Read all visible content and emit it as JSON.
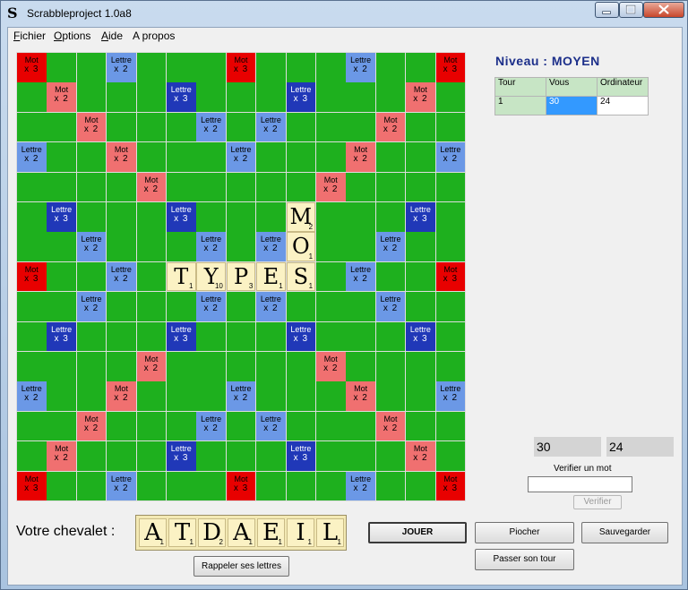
{
  "window": {
    "title": "Scrabbleproject 1.0a8",
    "app_icon": "S"
  },
  "menu": [
    {
      "label": "Fichier",
      "mnemonic": "F",
      "rest": "ichier"
    },
    {
      "label": "Options",
      "mnemonic": "O",
      "rest": "ptions"
    },
    {
      "label": "Aide",
      "mnemonic": "A",
      "rest": "ide"
    },
    {
      "label": "A propos",
      "mnemonic": "",
      "rest": "A propos"
    }
  ],
  "colors": {
    "board_green": "#1eb01e",
    "mot_x3": "#e80000",
    "mot_x2": "#f07070",
    "lettre_x2": "#6b98e6",
    "lettre_x3": "#2038b8",
    "tile": "#fbf2c4",
    "niveau_text": "#1c2f8a"
  },
  "bonus_labels": {
    "mot": "Mot",
    "lettre": "Lettre",
    "x2": "x 2",
    "x3": "x 3"
  },
  "board": {
    "size": 15,
    "mot_x3": [
      [
        0,
        0
      ],
      [
        0,
        7
      ],
      [
        0,
        14
      ],
      [
        7,
        0
      ],
      [
        7,
        14
      ],
      [
        14,
        0
      ],
      [
        14,
        7
      ],
      [
        14,
        14
      ]
    ],
    "mot_x2": [
      [
        1,
        1
      ],
      [
        2,
        2
      ],
      [
        3,
        3
      ],
      [
        4,
        4
      ],
      [
        1,
        13
      ],
      [
        2,
        12
      ],
      [
        3,
        11
      ],
      [
        4,
        10
      ],
      [
        10,
        4
      ],
      [
        11,
        3
      ],
      [
        12,
        2
      ],
      [
        13,
        1
      ],
      [
        10,
        10
      ],
      [
        11,
        11
      ],
      [
        12,
        12
      ],
      [
        13,
        13
      ]
    ],
    "lettre_x3": [
      [
        1,
        5
      ],
      [
        1,
        9
      ],
      [
        5,
        1
      ],
      [
        5,
        5
      ],
      [
        5,
        9
      ],
      [
        5,
        13
      ],
      [
        9,
        1
      ],
      [
        9,
        5
      ],
      [
        9,
        9
      ],
      [
        9,
        13
      ],
      [
        13,
        5
      ],
      [
        13,
        9
      ]
    ],
    "lettre_x2": [
      [
        0,
        3
      ],
      [
        0,
        11
      ],
      [
        2,
        6
      ],
      [
        2,
        8
      ],
      [
        3,
        0
      ],
      [
        3,
        7
      ],
      [
        3,
        14
      ],
      [
        6,
        2
      ],
      [
        6,
        6
      ],
      [
        6,
        8
      ],
      [
        6,
        12
      ],
      [
        7,
        3
      ],
      [
        7,
        11
      ],
      [
        8,
        2
      ],
      [
        8,
        6
      ],
      [
        8,
        8
      ],
      [
        8,
        12
      ],
      [
        11,
        0
      ],
      [
        11,
        7
      ],
      [
        11,
        14
      ],
      [
        12,
        6
      ],
      [
        12,
        8
      ],
      [
        14,
        3
      ],
      [
        14,
        11
      ]
    ],
    "tiles": [
      {
        "row": 5,
        "col": 9,
        "letter": "M",
        "value": "2"
      },
      {
        "row": 6,
        "col": 9,
        "letter": "O",
        "value": "1"
      },
      {
        "row": 7,
        "col": 5,
        "letter": "T",
        "value": "1"
      },
      {
        "row": 7,
        "col": 6,
        "letter": "Y",
        "value": "10"
      },
      {
        "row": 7,
        "col": 7,
        "letter": "P",
        "value": "3"
      },
      {
        "row": 7,
        "col": 8,
        "letter": "E",
        "value": "1"
      },
      {
        "row": 7,
        "col": 9,
        "letter": "S",
        "value": "1"
      }
    ]
  },
  "niveau": "Niveau : MOYEN",
  "score_table": {
    "headers": [
      "Tour",
      "Vous",
      "Ordinateur"
    ],
    "rows": [
      [
        "1",
        "30",
        "24"
      ]
    ]
  },
  "scores": {
    "vous": "30",
    "ordinateur": "24"
  },
  "verifier": {
    "label": "Verifier un mot",
    "value": "",
    "button": "Verifier"
  },
  "rack": {
    "label": "Votre chevalet :",
    "tiles": [
      {
        "letter": "A",
        "value": "1"
      },
      {
        "letter": "T",
        "value": "1"
      },
      {
        "letter": "D",
        "value": "2"
      },
      {
        "letter": "A",
        "value": "1"
      },
      {
        "letter": "E",
        "value": "1"
      },
      {
        "letter": "I",
        "value": "1"
      },
      {
        "letter": "L",
        "value": "1"
      }
    ]
  },
  "buttons": {
    "jouer": "JOUER",
    "piocher": "Piocher",
    "sauvegarder": "Sauvegarder",
    "passer": "Passer son tour",
    "rappeler": "Rappeler ses lettres"
  }
}
